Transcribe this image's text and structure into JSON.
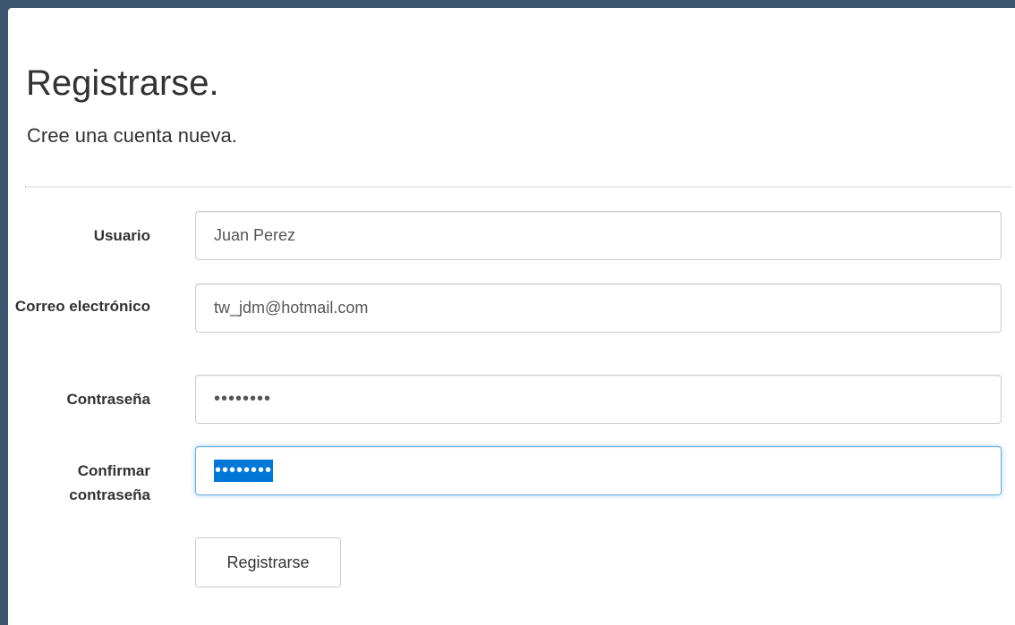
{
  "page": {
    "title": "Registrarse.",
    "subtitle": "Cree una cuenta nueva."
  },
  "form": {
    "username": {
      "label": "Usuario",
      "value": "Juan Perez"
    },
    "email": {
      "label": "Correo electrónico",
      "value": "tw_jdm@hotmail.com"
    },
    "password": {
      "label": "Contraseña",
      "masked_value": "••••••••"
    },
    "confirm_password": {
      "label_line1": "Confirmar",
      "label_line2": "contraseña",
      "masked_value": "••••••••",
      "state": "focused, text selected"
    },
    "submit_label": "Registrarse"
  },
  "colors": {
    "window_frame": "#3d5670",
    "background": "#ffffff",
    "text": "#333333",
    "input_text": "#555555",
    "input_border": "#cccccc",
    "focus_border": "#66afe9",
    "selection": "#0078d7"
  }
}
